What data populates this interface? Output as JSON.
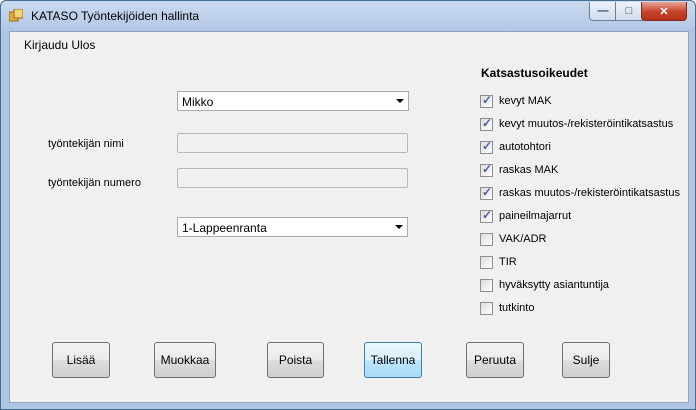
{
  "window": {
    "title": "KATASO Työntekijöiden hallinta"
  },
  "menu": {
    "items": [
      "Kirjaudu Ulos"
    ]
  },
  "form": {
    "employee_select": "Mikko",
    "name_label": "työntekijän nimi",
    "name_value": "",
    "number_label": "työntekijän numero",
    "number_value": "",
    "location_select": "1-Lappeenranta"
  },
  "permissions": {
    "title": "Katsastusoikeudet",
    "items": [
      {
        "label": "kevyt MAK",
        "checked": true
      },
      {
        "label": "kevyt muutos-/rekisteröintikatsastus",
        "checked": true
      },
      {
        "label": "autotohtori",
        "checked": true
      },
      {
        "label": "raskas MAK",
        "checked": true
      },
      {
        "label": "raskas muutos-/rekisteröintikatsastus",
        "checked": true
      },
      {
        "label": "paineilmajarrut",
        "checked": true
      },
      {
        "label": "VAK/ADR",
        "checked": false
      },
      {
        "label": "TIR",
        "checked": false
      },
      {
        "label": "hyväksytty asiantuntija",
        "checked": false
      },
      {
        "label": "tutkinto",
        "checked": false
      }
    ]
  },
  "buttons": {
    "add": "Lisää",
    "edit": "Muokkaa",
    "delete": "Poista",
    "save": "Tallenna",
    "cancel": "Peruuta",
    "close": "Sulje"
  },
  "colors": {
    "check": "#4c61a8",
    "focused_button": "#bee6fd"
  }
}
